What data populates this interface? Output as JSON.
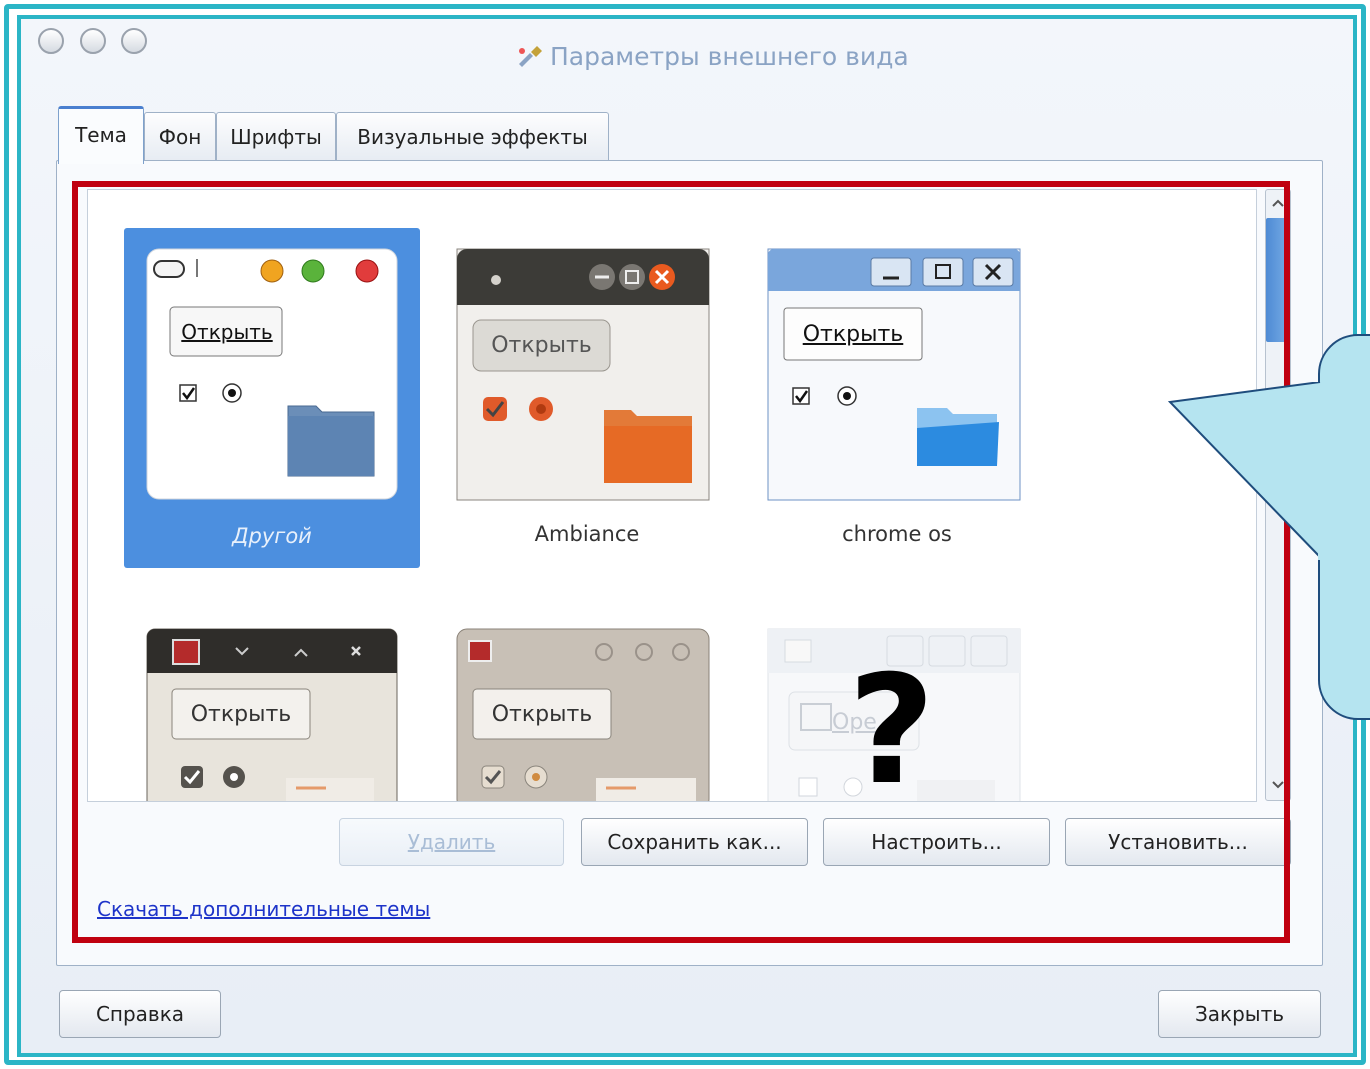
{
  "window": {
    "title": "Параметры внешнего вида",
    "title_icon": "paintbrush-icon"
  },
  "tabs": [
    {
      "label": "Тема",
      "active": true
    },
    {
      "label": "Фон",
      "active": false
    },
    {
      "label": "Шрифты",
      "active": false
    },
    {
      "label": "Визуальные эффекты",
      "active": false
    }
  ],
  "themes": [
    {
      "name": "Другой",
      "selected": true,
      "preview_button": "Открыть"
    },
    {
      "name": "Ambiance",
      "selected": false,
      "preview_button": "Открыть"
    },
    {
      "name": "chrome os",
      "selected": false,
      "preview_button": "Открыть"
    },
    {
      "name": "",
      "selected": false,
      "preview_button": "Открыть"
    },
    {
      "name": "",
      "selected": false,
      "preview_button": "Открыть"
    },
    {
      "name": "",
      "selected": false,
      "preview_button": "Ope"
    }
  ],
  "question_mark": "?",
  "actions": {
    "delete": "Удалить",
    "save_as": "Сохранить как...",
    "customize": "Настроить...",
    "install": "Установить..."
  },
  "download_link": "Скачать дополнительные темы",
  "footer": {
    "help": "Справка",
    "close": "Закрыть"
  },
  "colors": {
    "frame": "#2bb5c6",
    "highlight": "#c00010",
    "selection": "#4c8fdf",
    "callout": "#b5e4f0"
  }
}
